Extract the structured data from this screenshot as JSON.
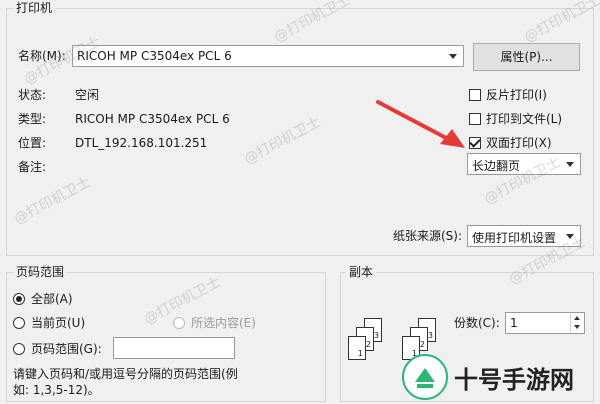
{
  "printer_group": {
    "title": "打印机",
    "name_label": "名称(M):",
    "printer_name": "RICOH MP C3504ex PCL 6",
    "properties_button": "属性(P)...",
    "status_label": "状态:",
    "status_value": "空闲",
    "type_label": "类型:",
    "type_value": "RICOH MP C3504ex PCL 6",
    "location_label": "位置:",
    "location_value": "DTL_192.168.101.251",
    "comment_label": "备注:",
    "reverse_print": "反片打印(I)",
    "print_to_file": "打印到文件(L)",
    "duplex": "双面打印(X)",
    "duplex_checked": true,
    "flip_option": "长边翻页",
    "paper_source_label": "纸张来源(S):",
    "paper_source_value": "使用打印机设置"
  },
  "page_range_group": {
    "title": "页码范围",
    "all": "全部(A)",
    "current_page": "当前页(U)",
    "selection": "所选内容(E)",
    "pages": "页码范围(G):",
    "pages_value": "",
    "hint": "请键入页码和/或用逗号分隔的页码范围(例如: 1,3,5-12)。"
  },
  "copies_group": {
    "title": "副本",
    "copies_label": "份数(C):",
    "copies_value": "1"
  },
  "watermark_text": "@打印机卫士",
  "brand_text": "十号手游网",
  "colors": {
    "arrow": "#e63a3a",
    "brand_green": "#2bb673"
  }
}
